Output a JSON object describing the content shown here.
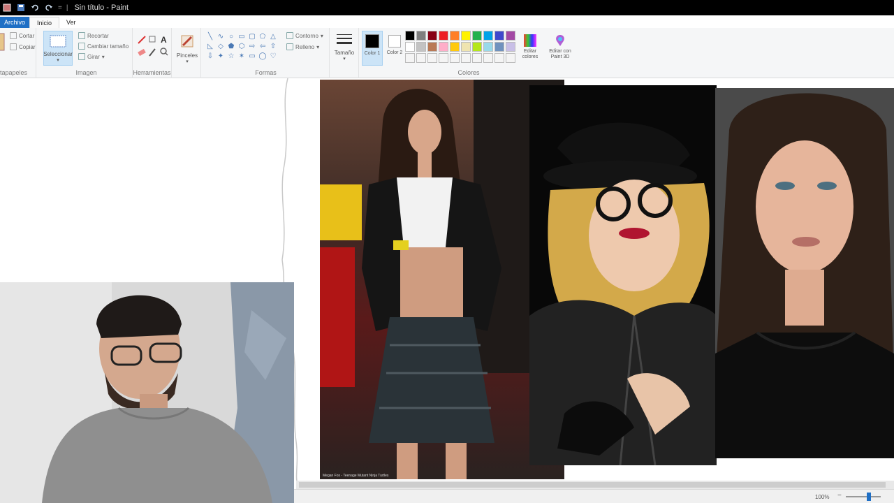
{
  "window": {
    "title": "Sin título - Paint",
    "quick_sep": "=",
    "sep": "|"
  },
  "tabs": [
    {
      "label": "Archivo"
    },
    {
      "label": "Inicio"
    },
    {
      "label": "Ver"
    }
  ],
  "ribbon": {
    "clipboard": {
      "label": "Portapapeles",
      "cut": "Cortar",
      "copy": "Copiar"
    },
    "image": {
      "label": "Imagen",
      "select": "Seleccionar",
      "crop": "Recortar",
      "resize": "Cambiar tamaño",
      "rotate": "Girar"
    },
    "tools": {
      "label": "Herramientas",
      "text_glyph": "A"
    },
    "brushes": {
      "label": "Pinceles"
    },
    "shapes": {
      "label": "Formas",
      "outline": "Contorno",
      "fill": "Relleno"
    },
    "size": {
      "label": "Tamaño"
    },
    "colors": {
      "label": "Colores",
      "color1": "Color 1",
      "color2": "Color 2",
      "edit_colors": "Editar colores",
      "edit_with_paint3d": "Editar con Paint 3D"
    }
  },
  "colors": {
    "accent": "#1f6fc5",
    "color1": "#000000",
    "color2": "#ffffff",
    "palette_row1": [
      "#000000",
      "#7f7f7f",
      "#880015",
      "#ed1c24",
      "#ff7f27",
      "#fff200",
      "#22b14c",
      "#00a2e8",
      "#3f48cc",
      "#a349a4"
    ],
    "palette_row2": [
      "#ffffff",
      "#c3c3c3",
      "#b97a57",
      "#ffaec9",
      "#ffc90e",
      "#efe4b0",
      "#b5e61d",
      "#99d9ea",
      "#7092be",
      "#c8bfe7"
    ],
    "palette_row3": [
      "#f4f4f4",
      "#f4f4f4",
      "#f4f4f4",
      "#f4f4f4",
      "#f4f4f4",
      "#f4f4f4",
      "#f4f4f4",
      "#f4f4f4",
      "#f4f4f4",
      "#f4f4f4"
    ]
  },
  "canvas": {
    "photo_caption": "Megan Fox - Teenage Mutant Ninja Turtles"
  },
  "status": {
    "zoom": "100%"
  }
}
